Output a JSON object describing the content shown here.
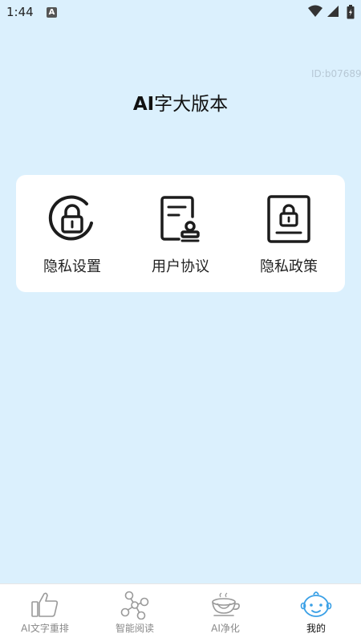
{
  "status_bar": {
    "time": "1:44",
    "notification_icon": "a-badge-icon",
    "icons": [
      "wifi-icon",
      "signal-icon",
      "battery-icon"
    ]
  },
  "header": {
    "id_text": "ID:b07689",
    "title_latin": "AI",
    "title_cjk": "字大版本"
  },
  "menu": {
    "items": [
      {
        "label": "隐私设置",
        "icon": "privacy-settings-icon"
      },
      {
        "label": "用户协议",
        "icon": "user-agreement-icon"
      },
      {
        "label": "隐私政策",
        "icon": "privacy-policy-icon"
      }
    ]
  },
  "bottom_nav": {
    "items": [
      {
        "label": "AI文字重排",
        "icon": "thumbs-up-icon"
      },
      {
        "label": "智能阅读",
        "icon": "molecule-icon"
      },
      {
        "label": "AI净化",
        "icon": "cup-icon"
      },
      {
        "label": "我的",
        "icon": "baby-face-icon"
      }
    ],
    "active_index": 3
  },
  "colors": {
    "background": "#dbf0fd",
    "card": "#ffffff",
    "active_nav_icon": "#3aa0e6",
    "inactive_nav": "#888888"
  }
}
